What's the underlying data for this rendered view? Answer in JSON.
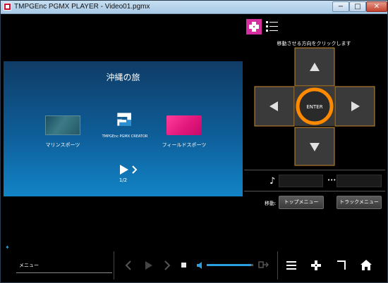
{
  "window": {
    "title": "TMPGEnc PGMX PLAYER - Video01.pgmx",
    "minimize_label": "−",
    "maximize_label": "□",
    "close_label": "✕"
  },
  "preview": {
    "menu_title": "沖縄の旅",
    "items": [
      {
        "label": "マリンスポーツ"
      },
      {
        "label": "TMPGEnc PGMX CREATOR"
      },
      {
        "label": "フィールドスポーツ"
      }
    ],
    "page": "1/2"
  },
  "remote": {
    "caption": "移動させる方向をクリックします",
    "enter_label": "ENTER",
    "move_label": "移動:",
    "top_menu_label": "トップメニュー",
    "track_menu_label": "トラックメニュー",
    "ring_color": "#ff8a00",
    "accent_color": "#d52f9e"
  },
  "controlbar": {
    "menu_value": "メニュー",
    "volume_percent": 95,
    "accent_color": "#2aa0e0"
  }
}
